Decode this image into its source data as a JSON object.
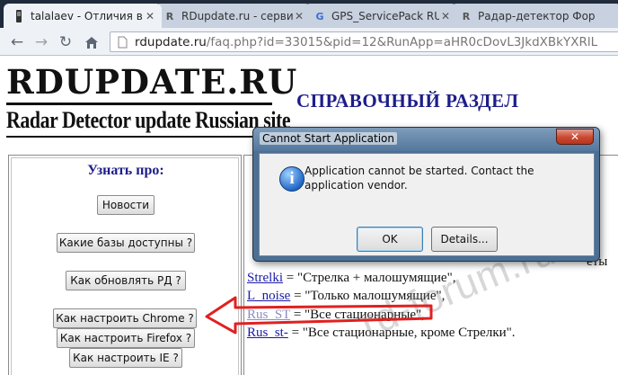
{
  "browser": {
    "tabs": [
      {
        "title": "talalaev - Отличия в",
        "icon": "person-icon",
        "active": true
      },
      {
        "title": "RDupdate.ru - серви",
        "icon": "rd-site-icon",
        "active": false
      },
      {
        "title": "GPS_ServicePack RU",
        "icon": "google-icon",
        "active": false
      },
      {
        "title": "Радар-детектор Фор",
        "icon": "rd-site-icon",
        "active": false
      }
    ],
    "url": {
      "host": "rdupdate.ru",
      "path": "/faq.php?id=33015&pid=12&RunApp=aHR0cDovL3JkdXBkYXRlL"
    }
  },
  "page": {
    "site_name": "RDUPDATE.RU",
    "tagline": "Radar Detector update Russian site",
    "section_title": "СПРАВОЧНЫЙ РАЗДЕЛ",
    "left_title": "Узнать про:",
    "buttons": {
      "news": "Новости",
      "databases": "Какие базы доступны ?",
      "update": "Как обновлять РД ?",
      "chrome": "Как настроить Chrome ?",
      "firefox": "Как настроить Firefox ?",
      "ie": "Как настроить IE ?"
    },
    "mappings": [
      {
        "code": "Strelki",
        "text": " = \"Стрелка + малошумящие\","
      },
      {
        "code": "L_noise",
        "text": " = \"Только малошумящие\","
      },
      {
        "code": "Rus_ST",
        "text": " = \"Все стационарные\","
      },
      {
        "code": "Rus_st-",
        "text": " = \"Все стационарные, кроме Стрелки\"."
      }
    ],
    "partial_right_text": "еты",
    "watermark": "rd-forum.ru"
  },
  "dialog": {
    "title": "Cannot Start Application",
    "message": "Application cannot be started. Contact the application vendor.",
    "ok_label": "OK",
    "details_label": "Details...",
    "close_glyph": "✕"
  },
  "colors": {
    "arrow": "#e02020",
    "heading_blue": "#1d1d8a",
    "link_blue": "#1a1aa6"
  }
}
